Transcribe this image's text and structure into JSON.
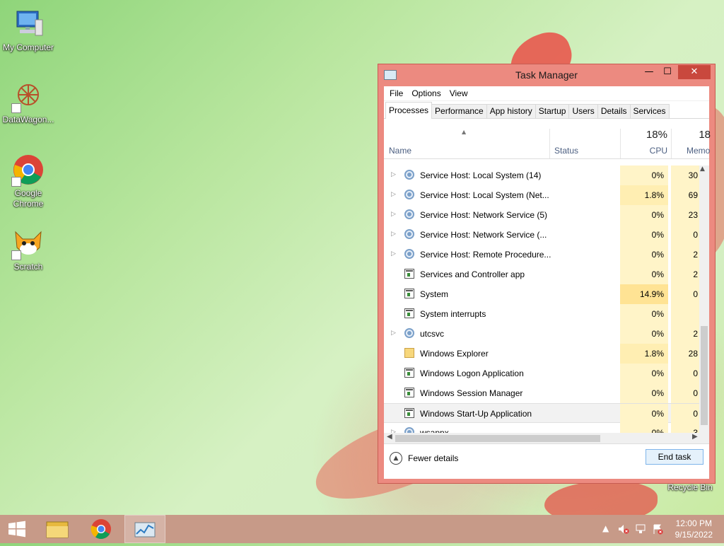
{
  "desktop": {
    "icons": [
      {
        "label": "My Computer"
      },
      {
        "label": "DataWagon..."
      },
      {
        "label": "Google Chrome"
      },
      {
        "label": "Scratch"
      },
      {
        "label": "Recycle Bin"
      }
    ]
  },
  "window": {
    "title": "Task Manager",
    "controls": {
      "minimize": "—",
      "maximize": "☐",
      "close": "✕"
    },
    "menu": [
      "File",
      "Options",
      "View"
    ],
    "tabs": [
      "Processes",
      "Performance",
      "App history",
      "Startup",
      "Users",
      "Details",
      "Services"
    ],
    "active_tab": "Processes",
    "columns": {
      "name": "Name",
      "status": "Status",
      "cpu_label": "CPU",
      "cpu_total": "18%",
      "memory_label": "Memo",
      "memory_total": "18"
    },
    "processes": [
      {
        "name": "Service Host: Local System (14)",
        "cpu": "0%",
        "memory": "30",
        "icon": "gear-icon",
        "expandable": true,
        "cpu_level": 0
      },
      {
        "name": "Service Host: Local System (Net...",
        "cpu": "1.8%",
        "memory": "69",
        "icon": "gear-icon",
        "expandable": true,
        "cpu_level": 1
      },
      {
        "name": "Service Host: Network Service (5)",
        "cpu": "0%",
        "memory": "23",
        "icon": "gear-icon",
        "expandable": true,
        "cpu_level": 0
      },
      {
        "name": "Service Host: Network Service (...",
        "cpu": "0%",
        "memory": "0",
        "icon": "gear-icon",
        "expandable": true,
        "cpu_level": 0
      },
      {
        "name": "Service Host: Remote Procedure...",
        "cpu": "0%",
        "memory": "2",
        "icon": "gear-icon",
        "expandable": true,
        "cpu_level": 0
      },
      {
        "name": "Services and Controller app",
        "cpu": "0%",
        "memory": "2",
        "icon": "window-icon",
        "expandable": false,
        "cpu_level": 0
      },
      {
        "name": "System",
        "cpu": "14.9%",
        "memory": "0",
        "icon": "window-icon",
        "expandable": false,
        "cpu_level": 2
      },
      {
        "name": "System interrupts",
        "cpu": "0%",
        "memory": "",
        "icon": "window-icon",
        "expandable": false,
        "cpu_level": 0
      },
      {
        "name": "utcsvc",
        "cpu": "0%",
        "memory": "2",
        "icon": "gear-icon",
        "expandable": true,
        "cpu_level": 0
      },
      {
        "name": "Windows Explorer",
        "cpu": "1.8%",
        "memory": "28",
        "icon": "folder-icon",
        "expandable": false,
        "cpu_level": 1
      },
      {
        "name": "Windows Logon Application",
        "cpu": "0%",
        "memory": "0",
        "icon": "window-icon",
        "expandable": false,
        "cpu_level": 0
      },
      {
        "name": "Windows Session Manager",
        "cpu": "0%",
        "memory": "0",
        "icon": "window-icon",
        "expandable": false,
        "cpu_level": 0
      },
      {
        "name": "Windows Start-Up Application",
        "cpu": "0%",
        "memory": "0",
        "icon": "window-icon",
        "expandable": false,
        "cpu_level": 0,
        "selected": true
      },
      {
        "name": "wsappx",
        "cpu": "0%",
        "memory": "3",
        "icon": "gear-icon",
        "expandable": true,
        "cpu_level": 0
      }
    ],
    "footer": {
      "fewer_details": "Fewer details",
      "end_task": "End task"
    }
  },
  "taskbar": {
    "clock_time": "12:00 PM",
    "clock_date": "9/15/2022"
  },
  "colors": {
    "window_frame": "#ec8a80",
    "close_button": "#c9483d",
    "taskbar": "#c79a88",
    "cpu_heat_low": "#fff4c8",
    "cpu_heat_mid": "#ffeeb2",
    "cpu_heat_high": "#ffe394"
  }
}
